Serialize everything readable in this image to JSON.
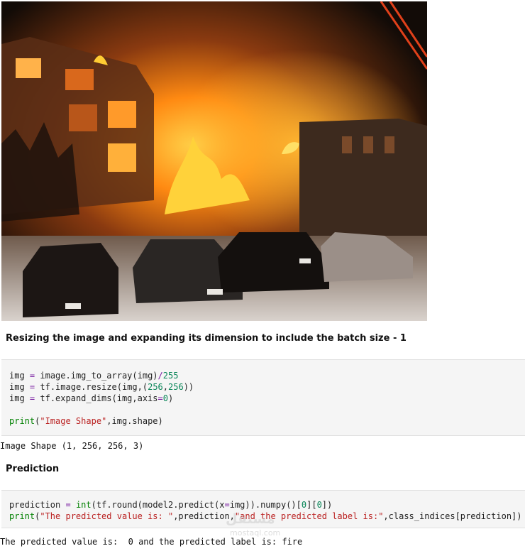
{
  "image": {
    "alt_subject": "burning building with cars in snow",
    "colors": {
      "fire": "#ff9a1a",
      "smoke": "#5c3b25",
      "night": "#0e0907"
    }
  },
  "cells": {
    "heading1": "Resizing the image and expanding its dimension to include the batch size - 1",
    "code1_lines": [
      "img = image.img_to_array(img)/255",
      "img = tf.image.resize(img,(256,256))",
      "img = tf.expand_dims(img,axis=0)",
      "",
      "print(\"Image Shape\",img.shape)"
    ],
    "output1": "Image Shape (1, 256, 256, 3)",
    "heading2": "Prediction",
    "code2_lines": [
      "prediction = int(tf.round(model2.predict(x=img)).numpy()[0][0])",
      "print(\"The predicted value is: \",prediction,\"and the predicted label is:\",class_indices[prediction])"
    ],
    "output2": "The predicted value is:  0 and the predicted label is: fire"
  },
  "watermark": {
    "text": "مستقل",
    "sub": "mostaql.com"
  }
}
